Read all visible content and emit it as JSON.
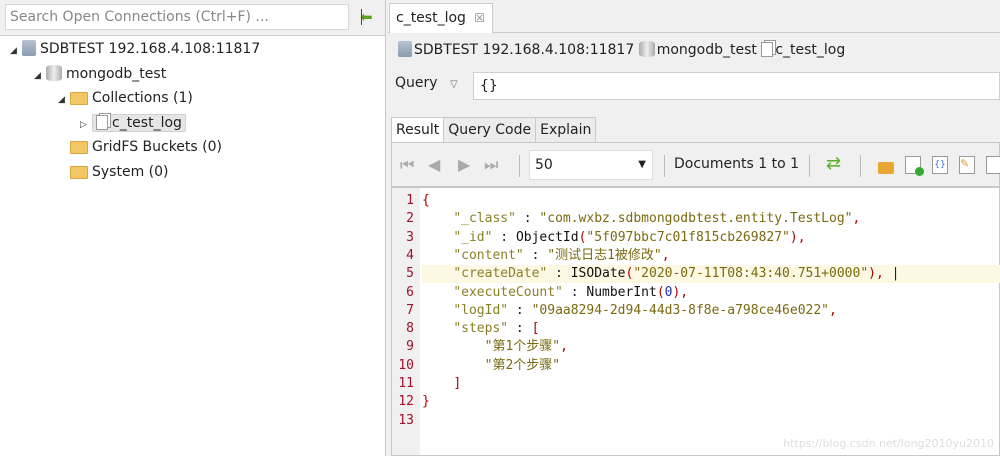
{
  "sidebar": {
    "search_placeholder": "Search Open Connections (Ctrl+F) ...",
    "tree": {
      "server": "SDBTEST 192.168.4.108:11817",
      "database": "mongodb_test",
      "collections": "Collections (1)",
      "collection": "c_test_log",
      "gridfs": "GridFS Buckets (0)",
      "system": "System (0)"
    }
  },
  "tab": {
    "label": "c_test_log"
  },
  "breadcrumb": {
    "server": "SDBTEST 192.168.4.108:11817",
    "database": "mongodb_test",
    "collection": "c_test_log"
  },
  "query": {
    "label": "Query",
    "value": "{}"
  },
  "result_tabs": [
    "Result",
    "Query Code",
    "Explain"
  ],
  "toolbar": {
    "page_size": "50",
    "documents": "Documents 1 to 1"
  },
  "editor": {
    "lines": [
      [
        [
          "p",
          "{"
        ]
      ],
      [
        [
          "o",
          "    "
        ],
        [
          "k",
          "\"_class\""
        ],
        [
          "o",
          " : "
        ],
        [
          "s",
          "\"com.wxbz.sdbmongodbtest.entity.TestLog\""
        ],
        [
          "p",
          ","
        ]
      ],
      [
        [
          "o",
          "    "
        ],
        [
          "k",
          "\"_id\""
        ],
        [
          "o",
          " : "
        ],
        [
          "f",
          "ObjectId"
        ],
        [
          "p",
          "("
        ],
        [
          "s",
          "\"5f097bbc7c01f815cb269827\""
        ],
        [
          "p",
          "),"
        ]
      ],
      [
        [
          "o",
          "    "
        ],
        [
          "k",
          "\"content\""
        ],
        [
          "o",
          " : "
        ],
        [
          "s",
          "\"测试日志1被修改\""
        ],
        [
          "p",
          ","
        ]
      ],
      [
        [
          "o",
          "    "
        ],
        [
          "k",
          "\"createDate\""
        ],
        [
          "o",
          " : "
        ],
        [
          "f",
          "ISODate"
        ],
        [
          "p",
          "("
        ],
        [
          "s",
          "\"2020-07-11T08:43:40.751+0000\""
        ],
        [
          "p",
          "),"
        ],
        [
          "o",
          " |"
        ]
      ],
      [
        [
          "o",
          "    "
        ],
        [
          "k",
          "\"executeCount\""
        ],
        [
          "o",
          " : "
        ],
        [
          "f",
          "NumberInt"
        ],
        [
          "p",
          "("
        ],
        [
          "n",
          "0"
        ],
        [
          "p",
          "),"
        ]
      ],
      [
        [
          "o",
          "    "
        ],
        [
          "k",
          "\"logId\""
        ],
        [
          "o",
          " : "
        ],
        [
          "s",
          "\"09aa8294-2d94-44d3-8f8e-a798ce46e022\""
        ],
        [
          "p",
          ","
        ]
      ],
      [
        [
          "o",
          "    "
        ],
        [
          "k",
          "\"steps\""
        ],
        [
          "o",
          " : "
        ],
        [
          "p",
          "["
        ]
      ],
      [
        [
          "o",
          "        "
        ],
        [
          "s",
          "\"第1个步骤\""
        ],
        [
          "p",
          ","
        ]
      ],
      [
        [
          "o",
          "        "
        ],
        [
          "s",
          "\"第2个步骤\""
        ]
      ],
      [
        [
          "o",
          "    "
        ],
        [
          "p",
          "]"
        ]
      ],
      [
        [
          "p",
          "}"
        ]
      ],
      []
    ],
    "highlight_line": 5
  },
  "watermark": "https://blog.csdn.net/long2010yu2010"
}
